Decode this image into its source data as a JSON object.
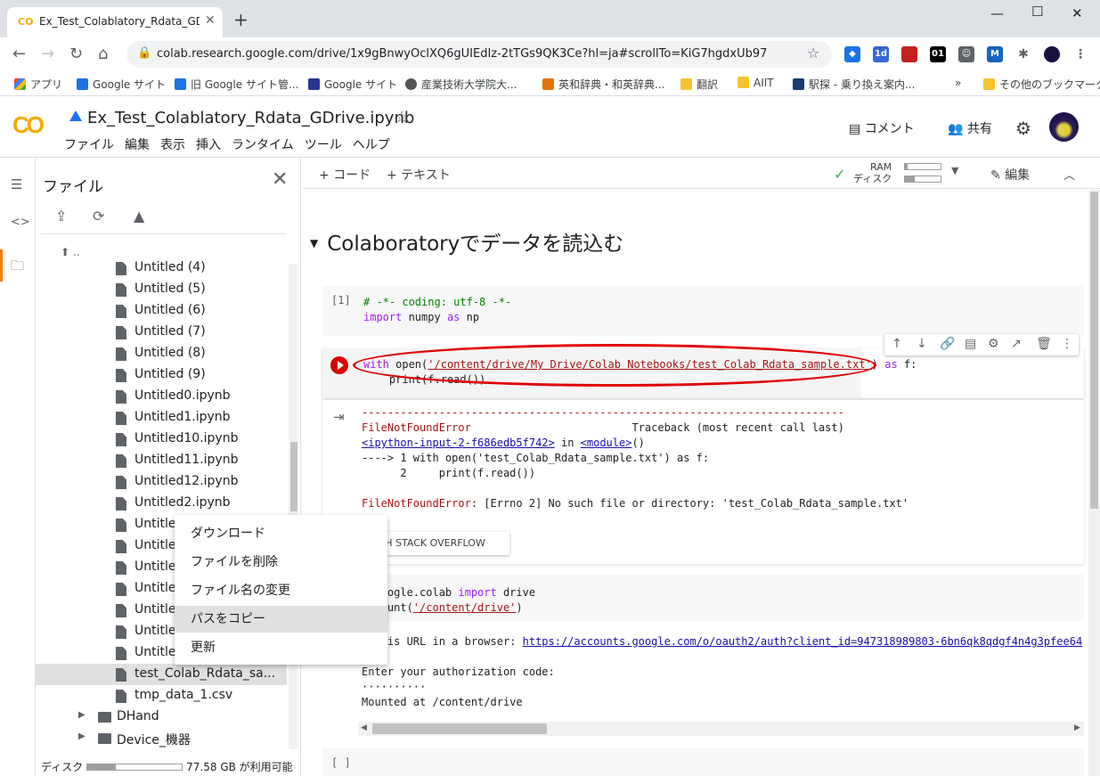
{
  "browser": {
    "tab_title": "Ex_Test_Colablatory_Rdata_GDrive",
    "url": "colab.research.google.com/drive/1x9gBnwyOclXQ6gUIEdIz-2tTGs9QK3Ce?hl=ja#scrollTo=KiG7hgdxUb97",
    "bookmarks": [
      "アプリ",
      "Google サイト",
      "旧 Google サイト管...",
      "Google サイト",
      "産業技術大学院大...",
      "英和辞典・和英辞典...",
      "翻訳",
      "AIIT",
      "駅探 - 乗り換え案内...",
      "»",
      "その他のブックマーク"
    ]
  },
  "colab": {
    "logo": "CO",
    "notebook_title": "Ex_Test_Colablatory_Rdata_GDrive.ipynb",
    "menu": [
      "ファイル",
      "編集",
      "表示",
      "挿入",
      "ランタイム",
      "ツール",
      "ヘルプ"
    ],
    "comment_label": "コメント",
    "share_label": "共有"
  },
  "files_panel": {
    "title": "ファイル",
    "parent": "..",
    "files": [
      "Untitled (4)",
      "Untitled (5)",
      "Untitled (6)",
      "Untitled (7)",
      "Untitled (8)",
      "Untitled (9)",
      "Untitled0.ipynb",
      "Untitled1.ipynb",
      "Untitled10.ipynb",
      "Untitled11.ipynb",
      "Untitled12.ipynb",
      "Untitled2.ipynb",
      "Untitlec",
      "Untitlec",
      "Untitlec",
      "Untitlec",
      "Untitlec",
      "Untitlec",
      "Untitlec",
      "test_Colab_Rdata_sa...",
      "tmp_data_1.csv"
    ],
    "folders": [
      "DHand",
      "Device_機器"
    ],
    "disk_label": "ディスク",
    "disk_free": "77.58 GB が利用可能"
  },
  "context_menu": {
    "items": [
      "ダウンロード",
      "ファイルを削除",
      "ファイル名の変更",
      "パスをコピー",
      "更新"
    ],
    "highlighted_index": 3
  },
  "notebook_toolbar": {
    "add_code": "+ コード",
    "add_text": "+ テキスト",
    "ram_label": "RAM",
    "disk_label": "ディスク",
    "edit_label": "編集"
  },
  "section_title": "Colaboratoryでデータを読込む",
  "cell1": {
    "prompt": "[1]",
    "line1": "# -*- coding: utf-8 -*-",
    "line2_kw1": "import",
    "line2_mid": " numpy ",
    "line2_kw2": "as",
    "line2_end": " np"
  },
  "cell2": {
    "kw_with": "with",
    "call": " open(",
    "path": "'/content/drive/My Drive/Colab Notebooks/test_Colab_Rdata_sample.txt'",
    "close": ") ",
    "kw_as": "as",
    "tail": " f:",
    "line2": "    print(f.read())"
  },
  "cell2_output": {
    "dashes": "---------------------------------------------------------------------------",
    "err_name": "FileNotFoundError",
    "traceback": "                         Traceback (most recent call last)",
    "input_link": "<ipython-input-2-f686edb5f742>",
    "in_text": " in ",
    "module": "<module>",
    "module_paren": "()",
    "arrow_line": "----> 1 with open('test_Colab_Rdata_sample.txt') as f:",
    "line_2": "      2     print(f.read())",
    "final_err_name": "FileNotFoundError",
    "final_err_msg": ": [Errno 2] No such file or directory: 'test_Colab_Rdata_sample.txt'",
    "so_button": "ARCH STACK OVERFLOW"
  },
  "cell3": {
    "line1_a": "  google.colab ",
    "line1_kw": "import",
    "line1_b": " drive",
    "line2_a": "e.mount(",
    "line2_str": "'/content/drive'",
    "line2_b": ")",
    "out_line1_a": "o this URL in a browser: ",
    "out_link": "https://accounts.google.com/o/oauth2/auth?client_id=947318989803-6bn6qk8qdgf4n4g3pfee64",
    "out_line2": "Enter your authorization code:",
    "out_line3": "··········",
    "out_line4": "Mounted at /content/drive"
  },
  "cell4": {
    "prompt": "[ ]"
  }
}
